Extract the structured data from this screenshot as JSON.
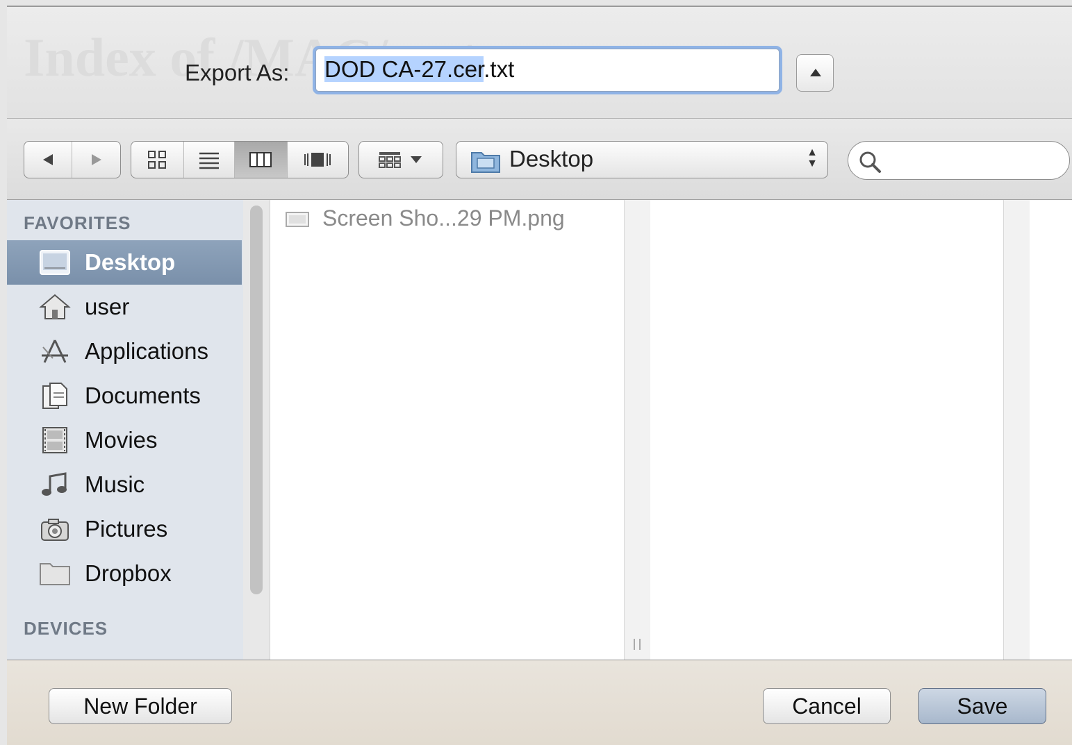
{
  "background": {
    "page_heading": "Index of /MAC/certs"
  },
  "header": {
    "export_label": "Export As:",
    "filename_selected": "DOD CA-27.cer",
    "filename_rest": ".txt"
  },
  "toolbar": {
    "back_icon": "triangle-left-icon",
    "forward_icon": "triangle-right-icon",
    "view_modes": [
      "icon-view",
      "list-view",
      "column-view",
      "cover-flow-view"
    ],
    "active_view": "column-view",
    "arrange_icon": "arrange-grid-icon",
    "location": "Desktop",
    "search_placeholder": ""
  },
  "sidebar": {
    "favorites_heading": "FAVORITES",
    "devices_heading": "DEVICES",
    "items": [
      {
        "label": "Desktop",
        "icon": "desktop-icon",
        "selected": true
      },
      {
        "label": "user",
        "icon": "home-icon"
      },
      {
        "label": "Applications",
        "icon": "applications-icon"
      },
      {
        "label": "Documents",
        "icon": "documents-icon"
      },
      {
        "label": "Movies",
        "icon": "movies-icon"
      },
      {
        "label": "Music",
        "icon": "music-icon"
      },
      {
        "label": "Pictures",
        "icon": "pictures-icon"
      },
      {
        "label": "Dropbox",
        "icon": "folder-icon"
      }
    ]
  },
  "files": [
    {
      "name": "Screen Sho...29 PM.png",
      "icon": "image-file-icon",
      "dimmed": true
    }
  ],
  "footer": {
    "new_folder_label": "New Folder",
    "cancel_label": "Cancel",
    "save_label": "Save"
  },
  "colors": {
    "selection_highlight": "#b5d3ff",
    "focus_ring": "#8fb3e6",
    "sidebar_selected": "#8ea3bb",
    "sidebar_bg": "#e0e5ec"
  }
}
